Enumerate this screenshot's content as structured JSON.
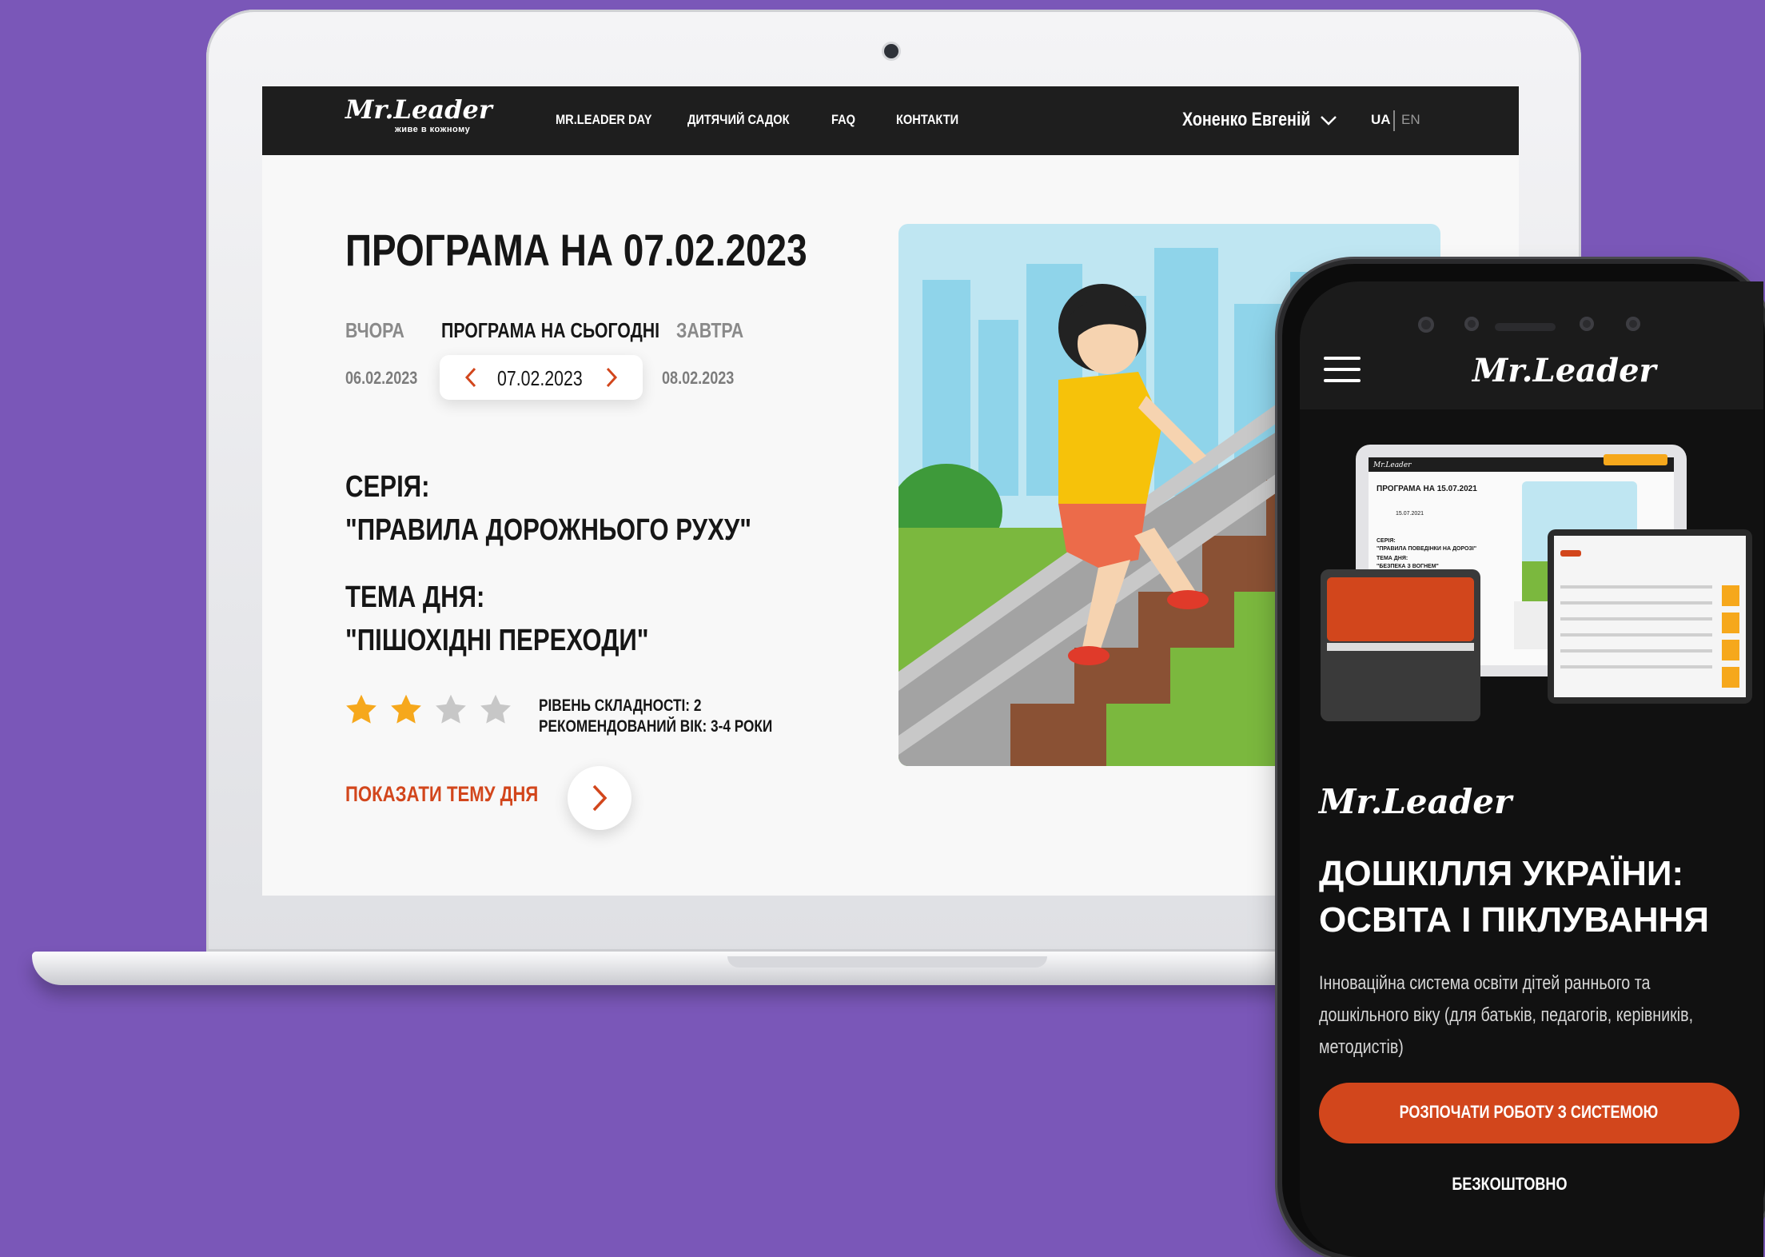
{
  "colors": {
    "background": "#7a57b8",
    "accent": "#d2461c",
    "navbar": "#1e1e1e",
    "star_filled": "#f6a81c",
    "star_empty": "#c7c7c7"
  },
  "laptop": {
    "navbar": {
      "logo": "Mr.Leader",
      "logo_tagline": "живе в кожному",
      "links": [
        "MR.LEADER DAY",
        "ДИТЯЧИЙ САДОК",
        "FAQ",
        "КОНТАКТИ"
      ],
      "user_name": "Хоненко Евгеній",
      "languages": [
        "UA",
        "EN"
      ],
      "active_language": "UA"
    },
    "page": {
      "title": "ПРОГРАМА НА 07.02.2023",
      "tabs": {
        "yesterday": "ВЧОРА",
        "today": "ПРОГРАМА НА СЬОГОДНІ",
        "tomorrow": "ЗАВТРА"
      },
      "dates": {
        "yesterday": "06.02.2023",
        "today": "07.02.2023",
        "tomorrow": "08.02.2023"
      },
      "series_label": "СЕРІЯ:",
      "series_value": "\"ПРАВИЛА ДОРОЖНЬОГО РУХУ\"",
      "topic_label": "ТЕМА ДНЯ:",
      "topic_value": "\"ПІШОХІДНІ ПЕРЕХОДИ\"",
      "difficulty_stars": 2,
      "difficulty_max": 4,
      "difficulty_text": "РІВЕНЬ СКЛАДНОСТІ: 2",
      "age_text": "РЕКОМЕНДОВАНИЙ ВІК: 3-4 РОКИ",
      "show_topic": "ПОКАЗАТИ ТЕМУ ДНЯ"
    }
  },
  "phone": {
    "header_logo": "Mr.Leader",
    "brand_logo": "Mr.Leader",
    "title": "ДОШКІЛЛЯ УКРАЇНИ: ОСВІТА І ПІКЛУВАННЯ",
    "description": "Інноваційна система освіти дітей раннього та дошкільного віку (для батьків, педагогів, керівників, методистів)",
    "cta": "РОЗПОЧАТИ РОБОТУ З СИСТЕМОЮ",
    "cta_note": "БЕЗКОШТОВНО",
    "mock": {
      "title": "ПРОГРАМА НА 15.07.2021",
      "date": "15.07.2021",
      "series_label": "СЕРІЯ:",
      "series_value": "\"ПРАВИЛА ПОВЕДІНКИ НА ДОРОЗІ\"",
      "topic_label": "ТЕМА ДНЯ:",
      "topic_value": "\"БЕЗПЕКА З ВОГНЕМ\""
    }
  }
}
